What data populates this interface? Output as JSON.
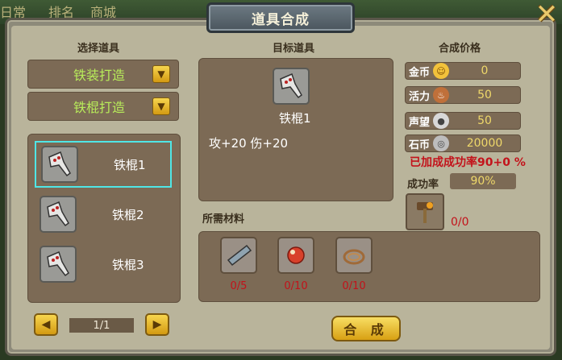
{
  "background": {
    "left_text": "日常",
    "mid_text": "排名",
    "right_text": "商城"
  },
  "dialog": {
    "title": "道具合成"
  },
  "select": {
    "label": "选择道具",
    "category": "铁装打造",
    "subcategory": "铁棍打造",
    "items": [
      {
        "name": "铁棍1",
        "selected": true
      },
      {
        "name": "铁棍2",
        "selected": false
      },
      {
        "name": "铁棍3",
        "selected": false
      }
    ],
    "page": "1/1"
  },
  "target": {
    "label": "目标道具",
    "name": "铁棍1",
    "stats": "攻+20  伤+20"
  },
  "materials": {
    "label": "所需材料",
    "items": [
      {
        "icon": "iron-bar-icon",
        "count": "0/5"
      },
      {
        "icon": "red-gem-icon",
        "count": "0/10"
      },
      {
        "icon": "rope-icon",
        "count": "0/10"
      }
    ]
  },
  "price": {
    "label": "合成价格",
    "rows": [
      {
        "label": "金币",
        "icon": "gold-coin-icon",
        "value": "0"
      },
      {
        "label": "活力",
        "icon": "meat-icon",
        "value": "50"
      },
      {
        "label": "声望",
        "icon": "medal-icon",
        "value": "50"
      },
      {
        "label": "石币",
        "icon": "stone-coin-icon",
        "value": "20000"
      }
    ]
  },
  "success": {
    "bonus_text": "已加成成功率90+0 %",
    "rate_label": "成功率",
    "rate_value": "90%",
    "stone_count": "0/0"
  },
  "compose_button": "合 成",
  "colors": {
    "accent_yellow": "#e3b12a",
    "panel_brown": "#7c6a55",
    "warning_red": "#c3121a",
    "selection_cyan": "#4fe6e6"
  }
}
